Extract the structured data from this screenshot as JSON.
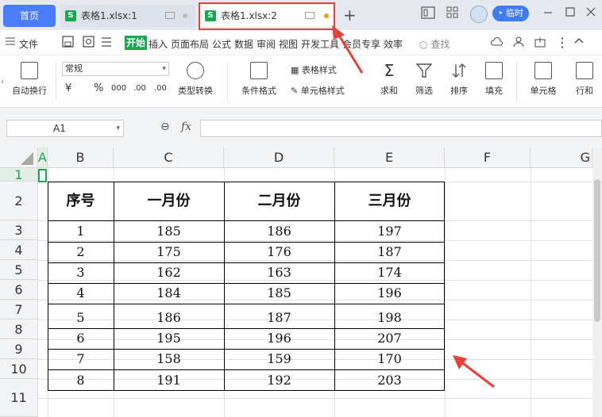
{
  "titlebar": {
    "home_tab": "首页",
    "tabs": [
      {
        "name": "表格1.xlsx:1",
        "logo": "S"
      },
      {
        "name": "表格1.xlsx:2",
        "logo": "S",
        "active": true
      }
    ],
    "login_label": "• 临时",
    "plus": "+"
  },
  "menu": {
    "file": "文件",
    "items": [
      "开始",
      "插入",
      "页面布局",
      "公式",
      "数据",
      "审阅",
      "视图",
      "开发工具",
      "会员专享",
      "效率"
    ],
    "search": "查找"
  },
  "ribbon": {
    "wrap": "自动换行",
    "number_format": "常规",
    "currency": "¥",
    "percent": "%",
    "thousand": "000",
    "dec_inc": ".00",
    "dec_dec": ".00",
    "type_convert": "类型转换",
    "cond_format": "条件格式",
    "table_style": "表格样式",
    "cell_style": "单元格样式",
    "sum": "求和",
    "filter": "筛选",
    "sort": "排序",
    "fill": "填充",
    "cell": "单元格",
    "rowcol": "行和"
  },
  "formula_bar": {
    "name_box": "A1",
    "fx": "fx"
  },
  "grid": {
    "columns": [
      "A",
      "B",
      "C",
      "D",
      "E",
      "F",
      "G"
    ],
    "rows": [
      "1",
      "2",
      "3",
      "4",
      "5",
      "6",
      "7",
      "8",
      "9",
      "10",
      "11"
    ],
    "headers": [
      "序号",
      "一月份",
      "二月份",
      "三月份"
    ],
    "data": [
      [
        "1",
        "185",
        "186",
        "197"
      ],
      [
        "2",
        "175",
        "176",
        "187"
      ],
      [
        "3",
        "162",
        "163",
        "174"
      ],
      [
        "4",
        "184",
        "185",
        "196"
      ],
      [
        "5",
        "186",
        "187",
        "198"
      ],
      [
        "6",
        "195",
        "196",
        "207"
      ],
      [
        "7",
        "158",
        "159",
        "170"
      ],
      [
        "8",
        "191",
        "192",
        "203"
      ]
    ]
  },
  "colors": {
    "accent": "#16a951",
    "tab_blue": "#4a7cff",
    "annotation_red": "#e8413a"
  }
}
